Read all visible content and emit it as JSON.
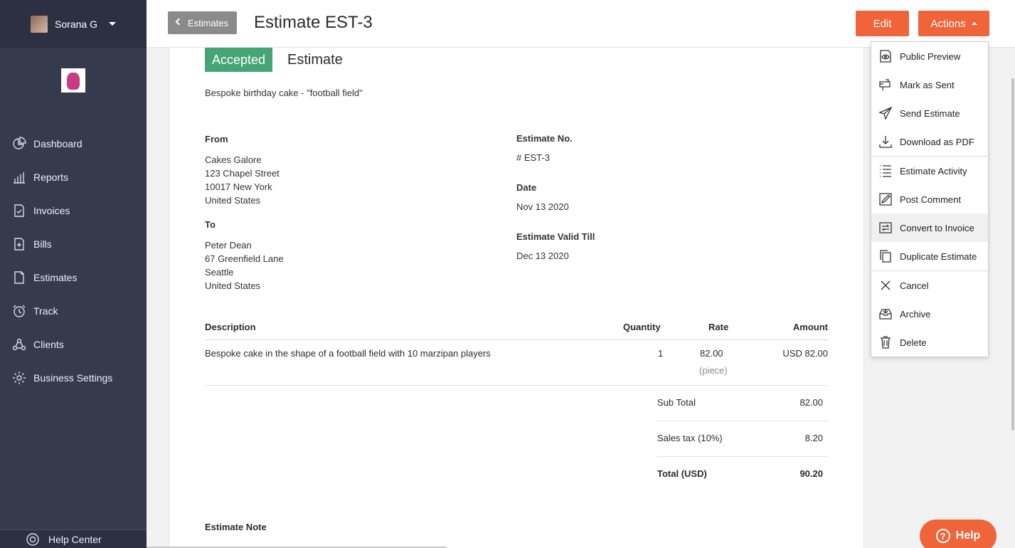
{
  "user": {
    "name": "Sorana G"
  },
  "sidebar": {
    "items": [
      {
        "label": "Dashboard",
        "icon": "pie-chart-icon"
      },
      {
        "label": "Reports",
        "icon": "bar-chart-icon"
      },
      {
        "label": "Invoices",
        "icon": "invoice-icon"
      },
      {
        "label": "Bills",
        "icon": "bill-icon"
      },
      {
        "label": "Estimates",
        "icon": "estimate-icon"
      },
      {
        "label": "Track",
        "icon": "clock-icon"
      },
      {
        "label": "Clients",
        "icon": "clients-icon"
      },
      {
        "label": "Business Settings",
        "icon": "gear-icon"
      }
    ],
    "help_center": "Help Center"
  },
  "header": {
    "back_label": "Estimates",
    "title": "Estimate EST-3",
    "edit_label": "Edit",
    "actions_label": "Actions"
  },
  "estimate": {
    "status": "Accepted",
    "doc_type": "Estimate",
    "summary": "Bespoke birthday cake - \"football field\"",
    "from_label": "From",
    "from_lines": [
      "Cakes Galore",
      "123 Chapel Street",
      "10017 New York",
      "United States"
    ],
    "to_label": "To",
    "to_lines": [
      "Peter Dean",
      "67 Greenfield Lane",
      "Seattle",
      "United States"
    ],
    "number_label": "Estimate No.",
    "number": "# EST-3",
    "date_label": "Date",
    "date": "Nov 13 2020",
    "valid_label": "Estimate Valid Till",
    "valid_till": "Dec 13 2020",
    "columns": {
      "description": "Description",
      "quantity": "Quantity",
      "rate": "Rate",
      "amount": "Amount"
    },
    "items": [
      {
        "description": "Bespoke cake in the shape of a football field with 10 marzipan players",
        "quantity": "1",
        "rate": "82.00",
        "unit": "(piece)",
        "amount": "USD 82.00"
      }
    ],
    "totals": {
      "subtotal_label": "Sub Total",
      "subtotal": "82.00",
      "tax_label": "Sales tax (10%)",
      "tax": "8.20",
      "total_label": "Total (USD)",
      "total": "90.20"
    },
    "note_label": "Estimate Note"
  },
  "actions_menu": {
    "groups": [
      [
        {
          "label": "Public Preview",
          "icon": "eye-icon"
        },
        {
          "label": "Mark as Sent",
          "icon": "mailbox-icon"
        },
        {
          "label": "Send Estimate",
          "icon": "paper-plane-icon"
        },
        {
          "label": "Download as PDF",
          "icon": "download-icon"
        }
      ],
      [
        {
          "label": "Estimate Activity",
          "icon": "list-icon"
        },
        {
          "label": "Post Comment",
          "icon": "pencil-icon"
        },
        {
          "label": "Convert to Invoice",
          "icon": "convert-icon"
        },
        {
          "label": "Duplicate Estimate",
          "icon": "duplicate-icon"
        }
      ],
      [
        {
          "label": "Cancel",
          "icon": "close-icon"
        },
        {
          "label": "Archive",
          "icon": "archive-icon"
        },
        {
          "label": "Delete",
          "icon": "trash-icon"
        }
      ]
    ]
  },
  "help_button": "Help",
  "colors": {
    "accent": "#f0643a",
    "sidebar": "#353a4d",
    "accepted": "#45a574"
  }
}
